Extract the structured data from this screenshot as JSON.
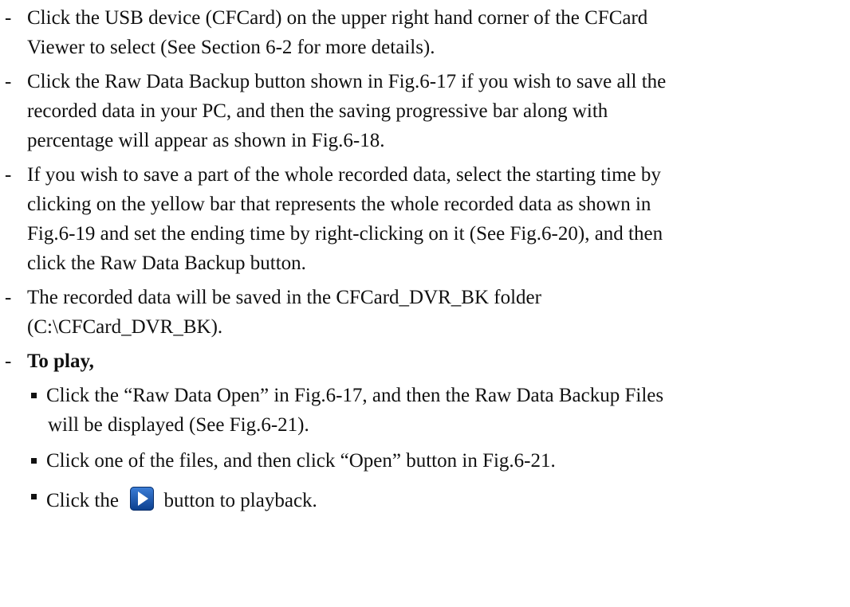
{
  "bullets": {
    "b1": {
      "l1": "Click the USB device (CFCard) on the upper right hand corner of the CFCard",
      "l2": "Viewer to select (See Section 6-2 for more details)."
    },
    "b2": {
      "l1": "Click the Raw Data Backup button shown in Fig.6-17 if you wish to save all the",
      "l2": "recorded data in your PC, and then the saving progressive bar along with",
      "l3": "percentage will appear as shown in Fig.6-18."
    },
    "b3": {
      "l1": "If you wish to save a part of the whole recorded data, select the starting time by",
      "l2": "clicking on the yellow bar that represents the whole recorded data as shown in",
      "l3": "Fig.6-19 and set the ending time by right-clicking on it (See Fig.6-20), and then",
      "l4": "click the Raw Data Backup button."
    },
    "b4": {
      "l1": "The recorded data will be saved in the CFCard_DVR_BK folder",
      "l2": "(C:\\CFCard_DVR_BK)."
    },
    "b5": {
      "l1": "To play,"
    }
  },
  "subbullets": {
    "s1": {
      "l1": "Click the “Raw Data Open” in Fig.6-17, and then the Raw Data Backup Files",
      "l2": "will be displayed (See Fig.6-21)."
    },
    "s2": {
      "l1": "Click one of the files, and then click “Open” button in Fig.6-21."
    },
    "s3": {
      "before": "Click the",
      "after": "button to playback.",
      "icon": "play-icon",
      "icon_color": "#1f5fbf"
    }
  },
  "dash_char": "-"
}
